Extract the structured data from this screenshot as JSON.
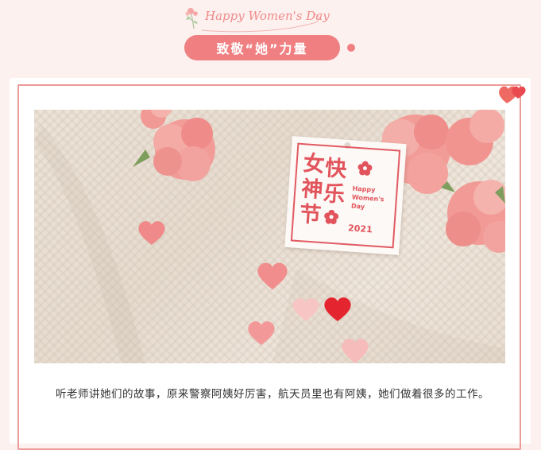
{
  "header": {
    "script_title": "Happy Women's Day",
    "banner_title": "致敬“她”力量",
    "accent_color": "#f07f81"
  },
  "photo": {
    "tag": {
      "chars": [
        "女",
        "快",
        "神",
        "乐",
        "节"
      ],
      "english_lines": [
        "Happy",
        "Women's",
        "Day"
      ],
      "year": "2021"
    }
  },
  "article": {
    "paragraph": "听老师讲她们的故事，原来警察阿姨好厉害，航天员里也有阿姨，她们做着很多的工作。"
  },
  "colors": {
    "page_bg": "#fdf1ef",
    "frame_border": "#ec9b98",
    "tag_red": "#e2545c"
  }
}
